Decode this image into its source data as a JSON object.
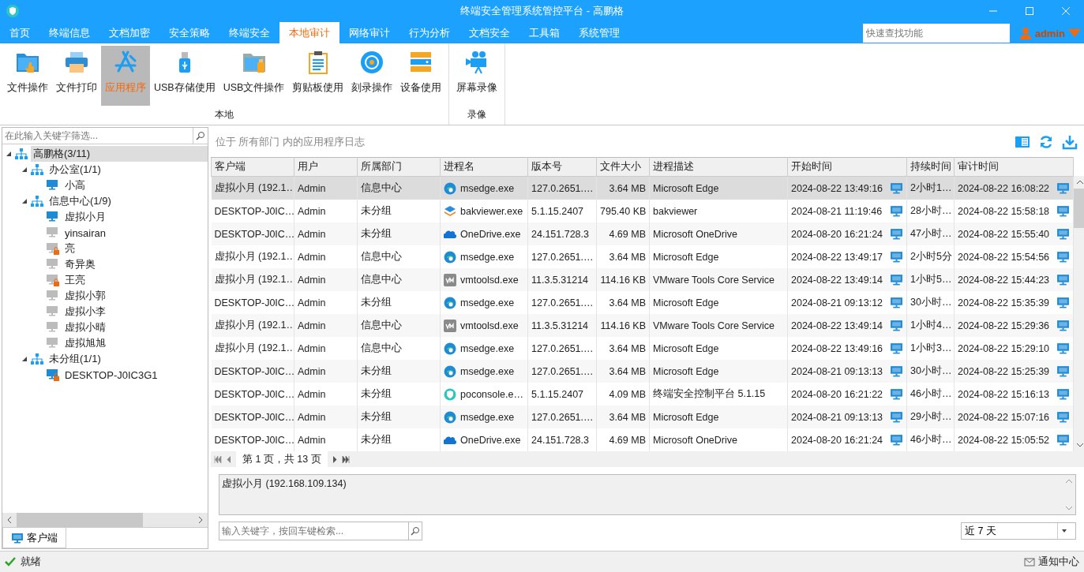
{
  "window": {
    "title": "终端安全管理系统管控平台 - 高鹏格"
  },
  "tabs": [
    {
      "label": "首页",
      "selected": false
    },
    {
      "label": "终端信息",
      "selected": false
    },
    {
      "label": "文档加密",
      "selected": false
    },
    {
      "label": "安全策略",
      "selected": false
    },
    {
      "label": "终端安全",
      "selected": false
    },
    {
      "label": "本地审计",
      "selected": true
    },
    {
      "label": "网络审计",
      "selected": false
    },
    {
      "label": "行为分析",
      "selected": false
    },
    {
      "label": "文档安全",
      "selected": false
    },
    {
      "label": "工具箱",
      "selected": false
    },
    {
      "label": "系统管理",
      "selected": false
    }
  ],
  "quick_search": {
    "placeholder": "快速查找功能"
  },
  "user": {
    "name": "admin"
  },
  "ribbon": [
    {
      "group": "本地",
      "items": [
        {
          "label": "文件操作",
          "kind": "folder-hand",
          "selected": false
        },
        {
          "label": "文件打印",
          "kind": "printer",
          "selected": false
        },
        {
          "label": "应用程序",
          "kind": "app",
          "selected": true
        },
        {
          "label": "USB存储使用",
          "kind": "usb",
          "selected": false
        },
        {
          "label": "USB文件操作",
          "kind": "usb-folder",
          "selected": false
        },
        {
          "label": "剪贴板使用",
          "kind": "clipboard",
          "selected": false
        },
        {
          "label": "刻录操作",
          "kind": "disc",
          "selected": false
        },
        {
          "label": "设备使用",
          "kind": "server",
          "selected": false
        }
      ]
    },
    {
      "group": "录像",
      "items": [
        {
          "label": "屏幕录像",
          "kind": "camera",
          "selected": false
        }
      ]
    }
  ],
  "sidebar": {
    "filter_placeholder": "在此输入关键字筛选...",
    "tree": [
      {
        "label": "高鹏格(3/11)",
        "kind": "group",
        "selected": true,
        "expanded": true,
        "children": [
          {
            "label": "办公室(1/1)",
            "kind": "group",
            "selected": false,
            "expanded": true,
            "children": [
              {
                "label": "小高",
                "kind": "pc",
                "online": true,
                "locked": false,
                "selected": false
              }
            ]
          },
          {
            "label": "信息中心(1/9)",
            "kind": "group",
            "selected": false,
            "expanded": true,
            "children": [
              {
                "label": "虚拟小月",
                "kind": "pc",
                "online": true,
                "locked": false,
                "selected": false
              },
              {
                "label": "yinsairan",
                "kind": "pc",
                "online": false,
                "locked": false,
                "selected": false
              },
              {
                "label": "亮",
                "kind": "pc",
                "online": false,
                "locked": true,
                "selected": false
              },
              {
                "label": "奇异奥",
                "kind": "pc",
                "online": false,
                "locked": false,
                "selected": false
              },
              {
                "label": "王亮",
                "kind": "pc",
                "online": false,
                "locked": true,
                "selected": false
              },
              {
                "label": "虚拟小郭",
                "kind": "pc",
                "online": false,
                "locked": false,
                "selected": false
              },
              {
                "label": "虚拟小李",
                "kind": "pc",
                "online": false,
                "locked": false,
                "selected": false
              },
              {
                "label": "虚拟小晴",
                "kind": "pc",
                "online": false,
                "locked": false,
                "selected": false
              },
              {
                "label": "虚拟旭旭",
                "kind": "pc",
                "online": false,
                "locked": false,
                "selected": false
              }
            ]
          },
          {
            "label": "未分组(1/1)",
            "kind": "group",
            "selected": false,
            "expanded": true,
            "children": [
              {
                "label": "DESKTOP-J0IC3G1",
                "kind": "pc",
                "online": true,
                "locked": true,
                "selected": false
              }
            ]
          }
        ]
      }
    ],
    "bottom_tab": {
      "label": "客户端",
      "selected": true
    }
  },
  "breadcrumb": "位于 所有部门 内的应用程序日志",
  "table": {
    "columns": [
      "客户端",
      "用户",
      "所属部门",
      "进程名",
      "版本号",
      "文件大小",
      "进程描述",
      "开始时间",
      "持续时间",
      "审计时间"
    ],
    "rows": [
      {
        "selected": true,
        "client": "虚拟小月 (192.1…",
        "user": "Admin",
        "dept": "信息中心",
        "process": "msedge.exe",
        "kind": "edge",
        "version": "127.0.2651.…",
        "size": "3.64 MB",
        "description": "Microsoft Edge",
        "start": "2024-08-22 13:49:16",
        "duration": "2小时1…",
        "audit": "2024-08-22 16:08:22"
      },
      {
        "selected": false,
        "client": "DESKTOP-J0IC…",
        "user": "Admin",
        "dept": "未分组",
        "process": "bakviewer.exe",
        "kind": "layers",
        "version": "5.1.15.2407",
        "size": "795.40 KB",
        "description": "bakviewer",
        "start": "2024-08-21 11:19:46",
        "duration": "28小时…",
        "audit": "2024-08-22 15:58:18"
      },
      {
        "selected": false,
        "client": "DESKTOP-J0IC…",
        "user": "Admin",
        "dept": "未分组",
        "process": "OneDrive.exe",
        "kind": "cloud",
        "version": "24.151.728.3",
        "size": "4.69 MB",
        "description": "Microsoft OneDrive",
        "start": "2024-08-20 16:21:24",
        "duration": "47小时…",
        "audit": "2024-08-22 15:55:40"
      },
      {
        "selected": false,
        "client": "虚拟小月 (192.1…",
        "user": "Admin",
        "dept": "信息中心",
        "process": "msedge.exe",
        "kind": "edge",
        "version": "127.0.2651.…",
        "size": "3.64 MB",
        "description": "Microsoft Edge",
        "start": "2024-08-22 13:49:17",
        "duration": "2小时5分",
        "audit": "2024-08-22 15:54:56"
      },
      {
        "selected": false,
        "client": "虚拟小月 (192.1…",
        "user": "Admin",
        "dept": "信息中心",
        "process": "vmtoolsd.exe",
        "kind": "vm",
        "version": "11.3.5.31214",
        "size": "114.16 KB",
        "description": "VMware Tools Core Service",
        "start": "2024-08-22 13:49:14",
        "duration": "1小时5…",
        "audit": "2024-08-22 15:44:23"
      },
      {
        "selected": false,
        "client": "DESKTOP-J0IC…",
        "user": "Admin",
        "dept": "未分组",
        "process": "msedge.exe",
        "kind": "edge",
        "version": "127.0.2651.…",
        "size": "3.64 MB",
        "description": "Microsoft Edge",
        "start": "2024-08-21 09:13:12",
        "duration": "30小时…",
        "audit": "2024-08-22 15:35:39"
      },
      {
        "selected": false,
        "client": "虚拟小月 (192.1…",
        "user": "Admin",
        "dept": "信息中心",
        "process": "vmtoolsd.exe",
        "kind": "vm",
        "version": "11.3.5.31214",
        "size": "114.16 KB",
        "description": "VMware Tools Core Service",
        "start": "2024-08-22 13:49:14",
        "duration": "1小时4…",
        "audit": "2024-08-22 15:29:36"
      },
      {
        "selected": false,
        "client": "虚拟小月 (192.1…",
        "user": "Admin",
        "dept": "信息中心",
        "process": "msedge.exe",
        "kind": "edge",
        "version": "127.0.2651.…",
        "size": "3.64 MB",
        "description": "Microsoft Edge",
        "start": "2024-08-22 13:49:16",
        "duration": "1小时3…",
        "audit": "2024-08-22 15:29:10"
      },
      {
        "selected": false,
        "client": "DESKTOP-J0IC…",
        "user": "Admin",
        "dept": "未分组",
        "process": "msedge.exe",
        "kind": "edge",
        "version": "127.0.2651.…",
        "size": "3.64 MB",
        "description": "Microsoft Edge",
        "start": "2024-08-21 09:13:13",
        "duration": "30小时…",
        "audit": "2024-08-22 15:25:39"
      },
      {
        "selected": false,
        "client": "DESKTOP-J0IC…",
        "user": "Admin",
        "dept": "未分组",
        "process": "poconsole.e…",
        "kind": "shield",
        "version": "5.1.15.2407",
        "size": "4.09 MB",
        "description": "终端安全控制平台 5.1.15",
        "start": "2024-08-20 16:21:22",
        "duration": "46小时…",
        "audit": "2024-08-22 15:16:13"
      },
      {
        "selected": false,
        "client": "DESKTOP-J0IC…",
        "user": "Admin",
        "dept": "未分组",
        "process": "msedge.exe",
        "kind": "edge",
        "version": "127.0.2651.…",
        "size": "3.64 MB",
        "description": "Microsoft Edge",
        "start": "2024-08-21 09:13:13",
        "duration": "29小时…",
        "audit": "2024-08-22 15:07:16"
      },
      {
        "selected": false,
        "client": "DESKTOP-J0IC…",
        "user": "Admin",
        "dept": "未分组",
        "process": "OneDrive.exe",
        "kind": "cloud",
        "version": "24.151.728.3",
        "size": "4.69 MB",
        "description": "Microsoft OneDrive",
        "start": "2024-08-20 16:21:24",
        "duration": "46小时…",
        "audit": "2024-08-22 15:05:52"
      }
    ]
  },
  "pager": "第 1 页，共 13 页",
  "detail": "虚拟小月 (192.168.109.134)",
  "keyword_search": {
    "placeholder": "输入关键字，按回车键检索..."
  },
  "range": {
    "value": "近 7 天"
  },
  "status_bar": {
    "text": "就绪",
    "notice": "通知中心"
  }
}
